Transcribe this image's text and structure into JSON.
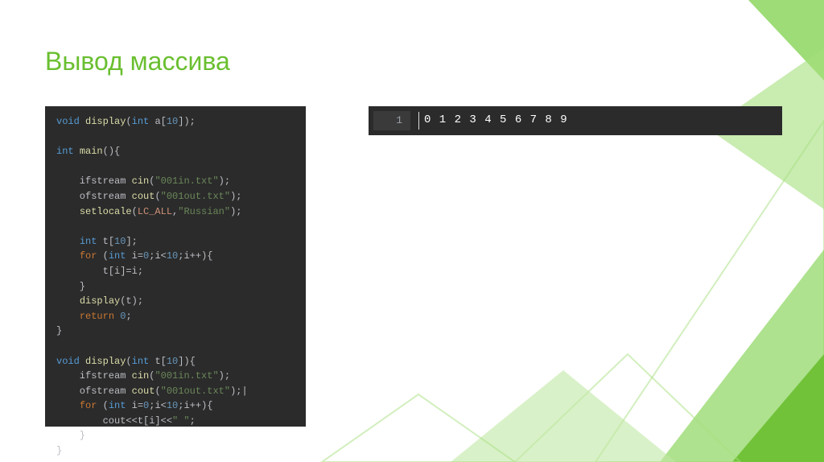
{
  "slide": {
    "title": "Вывод массива"
  },
  "code": {
    "lines": [
      [
        {
          "c": "type",
          "t": "void "
        },
        {
          "c": "fn",
          "t": "display"
        },
        {
          "c": "punct",
          "t": "("
        },
        {
          "c": "type",
          "t": "int "
        },
        {
          "c": "punct",
          "t": "a["
        },
        {
          "c": "num",
          "t": "10"
        },
        {
          "c": "punct",
          "t": "]);"
        }
      ],
      [],
      [
        {
          "c": "type",
          "t": "int "
        },
        {
          "c": "fn",
          "t": "main"
        },
        {
          "c": "punct",
          "t": "(){"
        }
      ],
      [],
      [
        {
          "c": "punct",
          "t": "    ifstream "
        },
        {
          "c": "fn",
          "t": "cin"
        },
        {
          "c": "punct",
          "t": "("
        },
        {
          "c": "str",
          "t": "\"001in.txt\""
        },
        {
          "c": "punct",
          "t": ");"
        }
      ],
      [
        {
          "c": "punct",
          "t": "    ofstream "
        },
        {
          "c": "fn",
          "t": "cout"
        },
        {
          "c": "punct",
          "t": "("
        },
        {
          "c": "str",
          "t": "\"001out.txt\""
        },
        {
          "c": "punct",
          "t": ");"
        }
      ],
      [
        {
          "c": "punct",
          "t": "    "
        },
        {
          "c": "fn",
          "t": "setlocale"
        },
        {
          "c": "punct",
          "t": "("
        },
        {
          "c": "const",
          "t": "LC_ALL"
        },
        {
          "c": "punct",
          "t": ","
        },
        {
          "c": "str",
          "t": "\"Russian\""
        },
        {
          "c": "punct",
          "t": ");"
        }
      ],
      [],
      [
        {
          "c": "punct",
          "t": "    "
        },
        {
          "c": "type",
          "t": "int "
        },
        {
          "c": "punct",
          "t": "t["
        },
        {
          "c": "num",
          "t": "10"
        },
        {
          "c": "punct",
          "t": "];"
        }
      ],
      [
        {
          "c": "punct",
          "t": "    "
        },
        {
          "c": "kw",
          "t": "for "
        },
        {
          "c": "punct",
          "t": "("
        },
        {
          "c": "type",
          "t": "int "
        },
        {
          "c": "punct",
          "t": "i="
        },
        {
          "c": "num",
          "t": "0"
        },
        {
          "c": "punct",
          "t": ";i<"
        },
        {
          "c": "num",
          "t": "10"
        },
        {
          "c": "punct",
          "t": ";i++){"
        }
      ],
      [
        {
          "c": "punct",
          "t": "        t[i]=i;"
        }
      ],
      [
        {
          "c": "punct",
          "t": "    }"
        }
      ],
      [
        {
          "c": "punct",
          "t": "    "
        },
        {
          "c": "fn",
          "t": "display"
        },
        {
          "c": "punct",
          "t": "(t);"
        }
      ],
      [
        {
          "c": "punct",
          "t": "    "
        },
        {
          "c": "kw",
          "t": "return "
        },
        {
          "c": "num",
          "t": "0"
        },
        {
          "c": "punct",
          "t": ";"
        }
      ],
      [
        {
          "c": "punct",
          "t": "}"
        }
      ],
      [],
      [
        {
          "c": "type",
          "t": "void "
        },
        {
          "c": "fn",
          "t": "display"
        },
        {
          "c": "punct",
          "t": "("
        },
        {
          "c": "type",
          "t": "int "
        },
        {
          "c": "punct",
          "t": "t["
        },
        {
          "c": "num",
          "t": "10"
        },
        {
          "c": "punct",
          "t": "]){"
        }
      ],
      [
        {
          "c": "punct",
          "t": "    ifstream "
        },
        {
          "c": "fn",
          "t": "cin"
        },
        {
          "c": "punct",
          "t": "("
        },
        {
          "c": "str",
          "t": "\"001in.txt\""
        },
        {
          "c": "punct",
          "t": ");"
        }
      ],
      [
        {
          "c": "punct",
          "t": "    ofstream "
        },
        {
          "c": "fn",
          "t": "cout"
        },
        {
          "c": "punct",
          "t": "("
        },
        {
          "c": "str",
          "t": "\"001out.txt\""
        },
        {
          "c": "punct",
          "t": ");|"
        }
      ],
      [
        {
          "c": "punct",
          "t": "    "
        },
        {
          "c": "kw",
          "t": "for "
        },
        {
          "c": "punct",
          "t": "("
        },
        {
          "c": "type",
          "t": "int "
        },
        {
          "c": "punct",
          "t": "i="
        },
        {
          "c": "num",
          "t": "0"
        },
        {
          "c": "punct",
          "t": ";i<"
        },
        {
          "c": "num",
          "t": "10"
        },
        {
          "c": "punct",
          "t": ";i++){"
        }
      ],
      [
        {
          "c": "punct",
          "t": "        cout<<t[i]<<"
        },
        {
          "c": "str",
          "t": "\" \""
        },
        {
          "c": "punct",
          "t": ";"
        }
      ],
      [
        {
          "c": "punct",
          "t": "    }"
        }
      ],
      [
        {
          "c": "punct",
          "t": "}"
        }
      ]
    ]
  },
  "output": {
    "lineno": "1",
    "text": "0 1 2 3 4 5 6 7 8 9"
  },
  "theme": {
    "accent": "#6abf30",
    "code_bg": "#2b2b2b"
  }
}
